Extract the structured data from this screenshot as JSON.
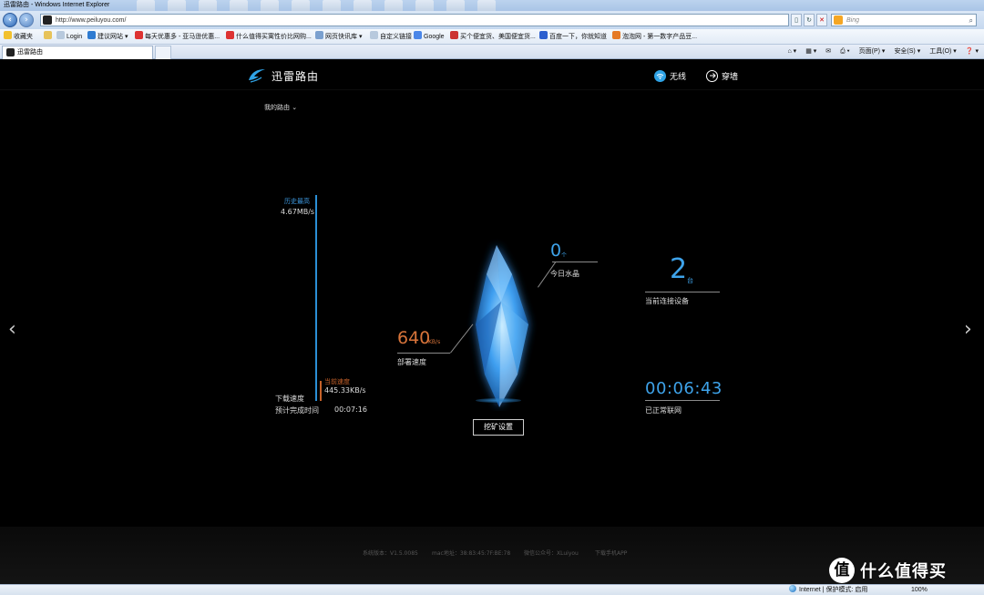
{
  "browser": {
    "window_title": "迅雷路由 - Windows Internet Explorer",
    "url": "http://www.peiluyou.com/",
    "search_placeholder": "Bing",
    "favorites": [
      {
        "label": "收藏夹",
        "icon": "star-icon"
      },
      {
        "label": "Login",
        "icon": "page-icon"
      },
      {
        "label": "建议网站 ▾",
        "icon": "ie-icon"
      },
      {
        "label": "每天优惠多 - 亚马逊优惠...",
        "icon": "amazon-icon"
      },
      {
        "label": "什么值得买寓性价比网购...",
        "icon": "smzdm-icon"
      },
      {
        "label": "网页快讯库 ▾",
        "icon": "feed-icon"
      },
      {
        "label": "自定义链接",
        "icon": "page-icon"
      },
      {
        "label": "Google",
        "icon": "google-icon"
      },
      {
        "label": "买个便宜货、美国便宜货...",
        "icon": "deal-icon"
      },
      {
        "label": "百度一下，你就知道",
        "icon": "baidu-icon"
      },
      {
        "label": "泡泡网 - 第一数字产品豆...",
        "icon": "pcpop-icon"
      }
    ],
    "tab_title": "迅雷路由",
    "commands": [
      "页面(P) ▾",
      "安全(S) ▾",
      "工具(O) ▾",
      "❓ ▾"
    ],
    "status_zone": "Internet | 保护模式: 启用",
    "zoom": "100%"
  },
  "page": {
    "brand_name": "迅雷路由",
    "nav": {
      "wireless": "无线",
      "tunnel": "穿墙"
    },
    "my_router": "我的路由 ⌄",
    "speed": {
      "peak_label": "历史最高",
      "peak_value": "4.67MB/s",
      "current_label": "当前速度",
      "current_value": "445.33KB/s",
      "download_label": "下载速度",
      "eta_label": "预计完成时间",
      "eta_value": "00:07:16"
    },
    "deploy": {
      "value": "640",
      "unit": "KB/s",
      "label": "部署速度"
    },
    "crystals": {
      "value": "0",
      "unit": "个",
      "label": "今日水晶"
    },
    "devices": {
      "value": "2",
      "unit": "台",
      "label": "当前连接设备"
    },
    "uptime": {
      "value": "00:06:43",
      "label": "已正常联网"
    },
    "mine_button": "挖矿设置",
    "footer": {
      "version": "系统版本：V1.5.0085",
      "mac": "mac地址：38:83:45:7F:BE:78",
      "wechat": "微信公众号：XLuiyou",
      "app": "下载手机APP"
    },
    "accent_blue": "#3ea3ea",
    "accent_orange": "#d8743a"
  },
  "watermark": {
    "badge": "值",
    "text": "什么值得买"
  }
}
